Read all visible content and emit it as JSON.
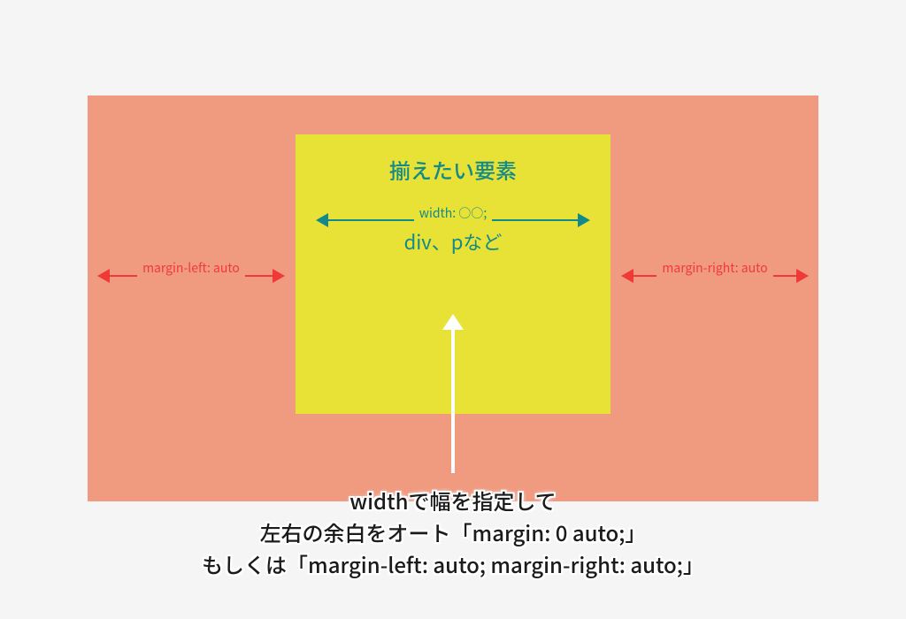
{
  "colors": {
    "outer_bg": "#f09a80",
    "inner_bg": "#e7e235",
    "inner_text": "#138a8a",
    "width_arrow": "#138a8a",
    "margin_arrow": "#ef3a3a",
    "pointer_arrow": "#ffffff",
    "caption_text": "#1b1b1b"
  },
  "inner_box": {
    "title": "揃えたい要素",
    "width_label": "width: ○○;",
    "example": "div、pなど"
  },
  "margins": {
    "left_label": "margin-left: auto",
    "right_label": "margin-right: auto"
  },
  "caption": {
    "line1": "widthで幅を指定して",
    "line2": "左右の余白をオート「margin: 0 auto;」",
    "line3": "もしくは「margin-left: auto; margin-right: auto;」"
  }
}
